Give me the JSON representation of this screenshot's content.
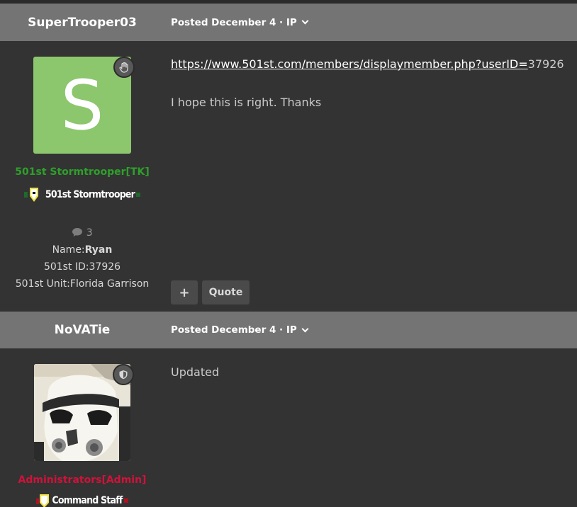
{
  "posts": [
    {
      "author": "SuperTrooper03",
      "posted": "Posted December 4 · IP",
      "avatar_letter": "S",
      "avatar_color": "#8cc66d",
      "group": "501st Stormtrooper[TK]",
      "group_color": "#2ea02a",
      "rank_image_text": "501st Stormtrooper",
      "post_count": "3",
      "name_label": "Name:",
      "name_value": "Ryan",
      "id_line": "501st ID:37926",
      "unit_line": "501st Unit:Florida Garrison",
      "link_text": "https://www.501st.com/members/displaymember.php?userID=",
      "link_suffix": "37926",
      "message": "I hope this is right.  Thanks",
      "plus_label": "+",
      "quote_label": "Quote"
    },
    {
      "author": "NoVATie",
      "posted": "Posted December 4 · IP",
      "group": "Administrators[Admin]",
      "group_color": "#d0123a",
      "rank_image_text": "Command Staff",
      "message": "Updated"
    }
  ]
}
